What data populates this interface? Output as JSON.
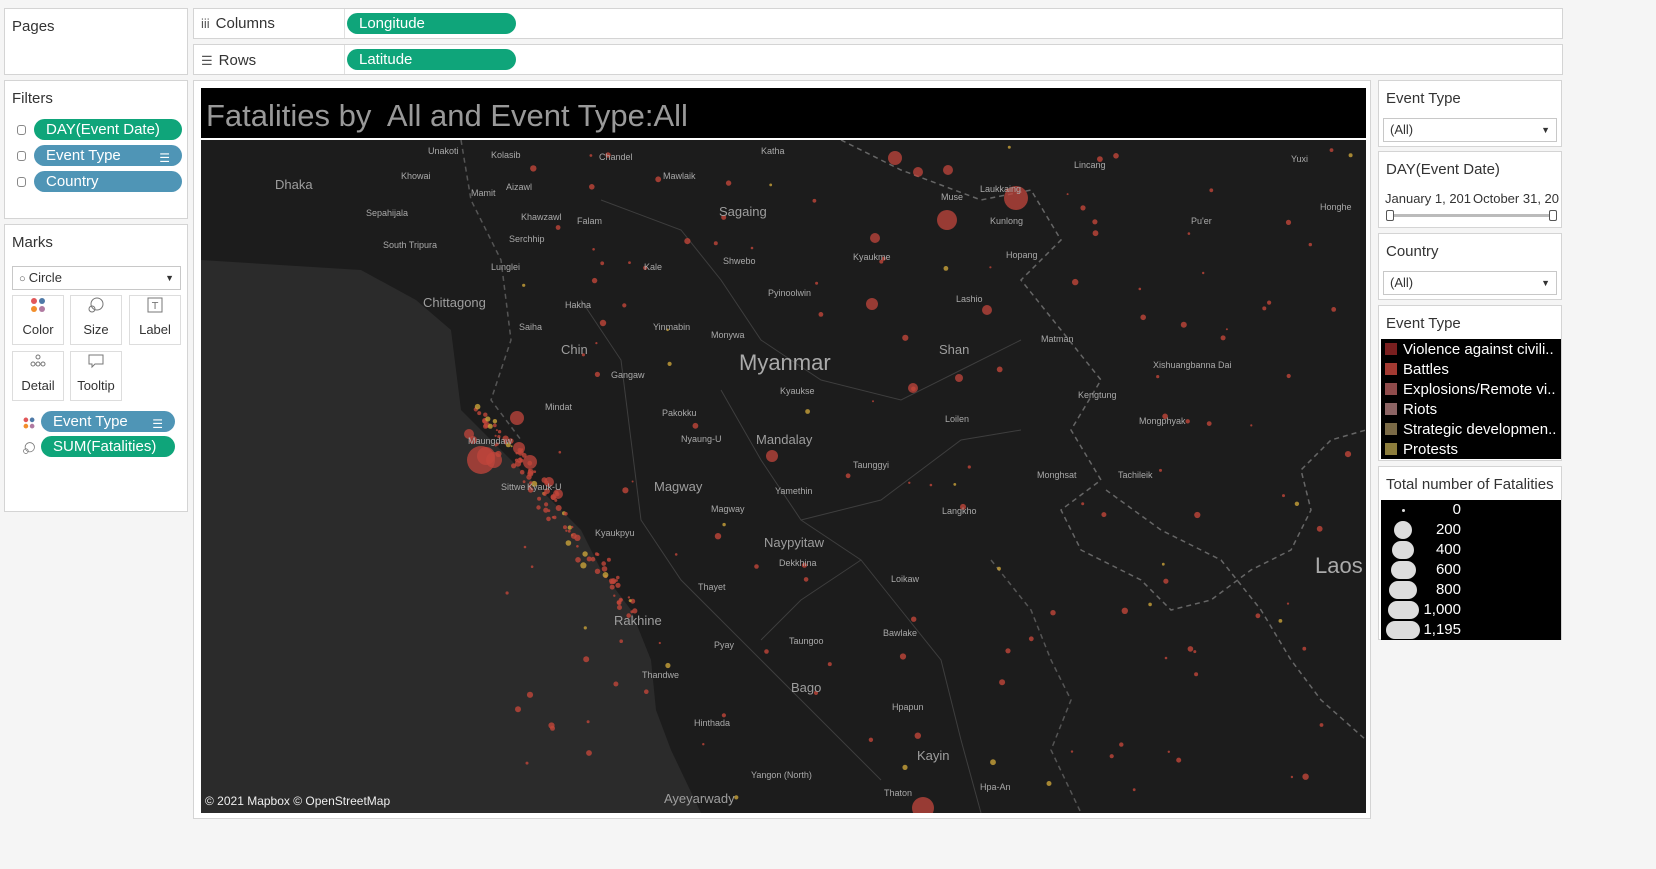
{
  "pages": {
    "title": "Pages"
  },
  "shelves": {
    "columns_label": "Columns",
    "columns_pill": "Longitude",
    "rows_label": "Rows",
    "rows_pill": "Latitude"
  },
  "filters": {
    "title": "Filters",
    "items": [
      "DAY(Event Date)",
      "Event Type",
      "Country"
    ]
  },
  "marks": {
    "title": "Marks",
    "mark_type": "Circle",
    "buttons": [
      "Color",
      "Size",
      "Label",
      "Detail",
      "Tooltip"
    ],
    "pills": [
      "Event Type",
      "SUM(Fatalities)"
    ]
  },
  "viz": {
    "title": "Fatalities by  All and Event Type:All",
    "attribution": "© 2021 Mapbox © OpenStreetMap",
    "country_labels": [
      "Myanmar",
      "Laos"
    ],
    "region_labels": [
      "Sagaing",
      "Chin",
      "Magway",
      "Mandalay",
      "Shan",
      "Naypyitaw",
      "Rakhine",
      "Bago",
      "Kayin",
      "Ayeyarwady",
      "Chittagong",
      "Dhaka"
    ],
    "town_labels": [
      "Unakoti",
      "Kolasib",
      "Chandel",
      "Katha",
      "Lincang",
      "Yuxi",
      "Khowai",
      "Mawlaik",
      "Muse",
      "Laukkaing",
      "Mamit",
      "Aizawl",
      "Sepahijala",
      "Khawzawl",
      "Falam",
      "Kunlong",
      "Pu'er",
      "Honghe",
      "South Tripura",
      "Serchhip",
      "Shwebo",
      "Kyaukme",
      "Hopang",
      "Lunglei",
      "Kale",
      "Pyinoolwin",
      "Lashio",
      "Hakha",
      "Saiha",
      "Yinmabin",
      "Monywa",
      "Matman",
      "Gangaw",
      "Xishuangbanna Dai",
      "Kyaukse",
      "Mindat",
      "Pakokku",
      "Kengtung",
      "Nyaung-U",
      "Loilen",
      "Mongphyak",
      "Taunggyi",
      "Monghsat",
      "Tachileik",
      "Sittwe",
      "Kyauk-U",
      "Maungdaw",
      "Yamethin",
      "Magway",
      "Langkho",
      "Dekkhina",
      "Kyaukpyu",
      "Thayet",
      "Loikaw",
      "Pyay",
      "Taungoo",
      "Bawlake",
      "Thandwe",
      "Hinthada",
      "Hpapun",
      "Yangon (North)",
      "Hpa-An",
      "Thaton"
    ]
  },
  "legend_filters": {
    "event_type_title": "Event Type",
    "event_type_value": "(All)",
    "date_title": "DAY(Event Date)",
    "date_start": "January 1, 201",
    "date_end": "October 31, 20",
    "country_title": "Country",
    "country_value": "(All)"
  },
  "color_legend": {
    "title": "Event Type",
    "items": [
      {
        "label": "Violence against civili..",
        "color": "#7a1f1f"
      },
      {
        "label": "Battles",
        "color": "#a33a32"
      },
      {
        "label": "Explosions/Remote vi..",
        "color": "#8f4b4b"
      },
      {
        "label": "Riots",
        "color": "#8c6464"
      },
      {
        "label": "Strategic developmen..",
        "color": "#7a6a46"
      },
      {
        "label": "Protests",
        "color": "#8c7d3c"
      }
    ]
  },
  "size_legend": {
    "title": "Total number of Fatalities",
    "items": [
      "0",
      "200",
      "400",
      "600",
      "800",
      "1,000",
      "1,195"
    ]
  }
}
